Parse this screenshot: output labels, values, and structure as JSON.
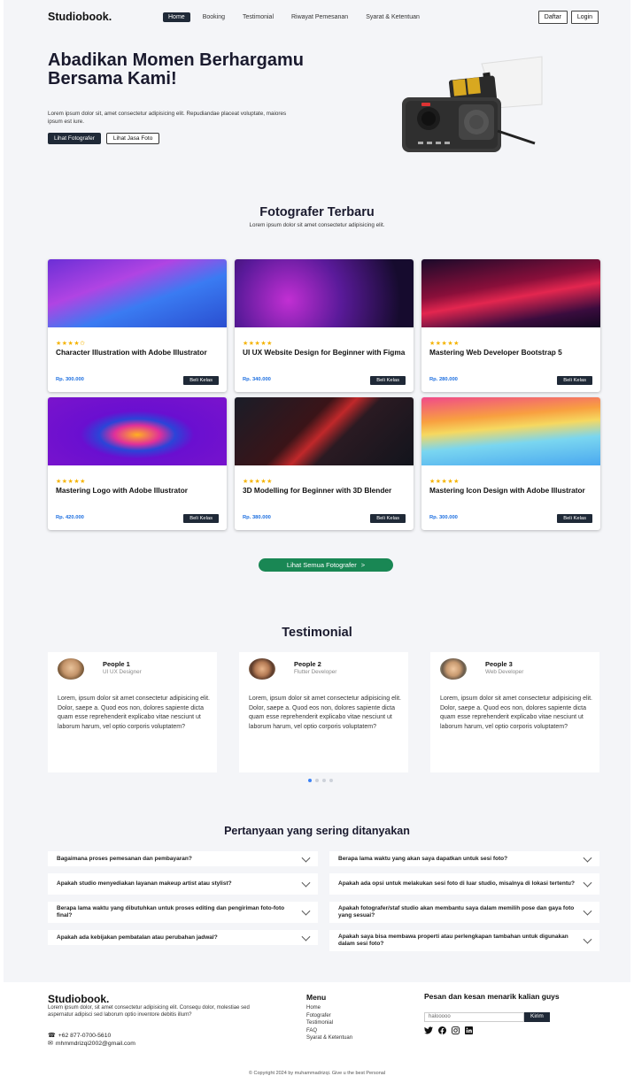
{
  "nav": {
    "brand": "Studiobook.",
    "items": [
      "Home",
      "Booking",
      "Testimonial",
      "Riwayat Pemesanan",
      "Syarat & Ketentuan"
    ],
    "active_index": 0,
    "register": "Daftar",
    "login": "Login"
  },
  "hero": {
    "title": "Abadikan Momen Berhargamu Bersama Kami!",
    "description": "Lorem ipsum dolor sit, amet consectetur adipisicing elit. Repudiandae placeat voluptate, maiores ipsum est iure.",
    "btn_primary": "Lihat Fotografer",
    "btn_secondary": "Lihat Jasa Foto"
  },
  "photographers": {
    "title": "Fotografer Terbaru",
    "subtitle": "Lorem ipsum dolor sit amet consectetur adipisicing elit.",
    "cards": [
      {
        "title": "Character Illustration with Adobe Illustrator",
        "price": "Rp. 300.000",
        "button": "Beli Kelas",
        "rating": 4.5,
        "stars": "★★★★✩"
      },
      {
        "title": "UI UX Website Design for Beginner with Figma",
        "price": "Rp. 340.000",
        "button": "Beli Kelas",
        "rating": 5,
        "stars": "★★★★★"
      },
      {
        "title": "Mastering Web Developer Bootstrap 5",
        "price": "Rp. 280.000",
        "button": "Beli Kelas",
        "rating": 5,
        "stars": "★★★★★"
      },
      {
        "title": "Mastering Logo with Adobe Illustrator",
        "price": "Rp. 420.000",
        "button": "Beli Kelas",
        "rating": 5,
        "stars": "★★★★★"
      },
      {
        "title": "3D Modelling for Beginner with 3D Blender",
        "price": "Rp. 380.000",
        "button": "Beli Kelas",
        "rating": 5,
        "stars": "★★★★★"
      },
      {
        "title": "Mastering Icon Design with Adobe Illustrator",
        "price": "Rp. 300.000",
        "button": "Beli Kelas",
        "rating": 5,
        "stars": "★★★★★"
      }
    ],
    "see_all": "Lihat Semua Fotografer",
    "see_all_arrow": ">"
  },
  "testimonial": {
    "title": "Testimonial",
    "items": [
      {
        "name": "People 1",
        "role": "UI UX Designer",
        "text": "Lorem, ipsum dolor sit amet consectetur adipisicing elit. Dolor, saepe a. Quod eos non, dolores sapiente dicta quam esse reprehenderit explicabo vitae nesciunt ut laborum harum, vel optio corporis voluptatem?"
      },
      {
        "name": "People 2",
        "role": "Flutter Developer",
        "text": "Lorem, ipsum dolor sit amet consectetur adipisicing elit. Dolor, saepe a. Quod eos non, dolores sapiente dicta quam esse reprehenderit explicabo vitae nesciunt ut laborum harum, vel optio corporis voluptatem?"
      },
      {
        "name": "People 3",
        "role": "Web Developer",
        "text": "Lorem, ipsum dolor sit amet consectetur adipisicing elit. Dolor, saepe a. Quod eos non, dolores sapiente dicta quam esse reprehenderit explicabo vitae nesciunt ut laborum harum, vel optio corporis voluptatem?"
      }
    ],
    "active_dot": 0
  },
  "faq": {
    "title": "Pertanyaan yang sering ditanyakan",
    "left": [
      "Bagaimana proses pemesanan dan pembayaran?",
      "Apakah studio menyediakan layanan makeup artist atau stylist?",
      "Berapa lama waktu yang dibutuhkan untuk proses editing dan pengiriman foto-foto final?",
      "Apakah ada kebijakan pembatalan atau perubahan jadwal?"
    ],
    "right": [
      "Berapa lama waktu yang akan saya dapatkan untuk sesi foto?",
      "Apakah ada opsi untuk melakukan sesi foto di luar studio, misalnya di lokasi tertentu?",
      "Apakah fotografer/staf studio akan membantu saya dalam memilih pose dan gaya foto yang sesuai?",
      "Apakah saya bisa membawa properti atau perlengkapan tambahan untuk digunakan dalam sesi foto?"
    ]
  },
  "footer": {
    "brand": "Studiobook.",
    "description": "Lorem ipsum dolor, sit amet consectetur adipisicing elit. Consequ dolor, molestiae sed aspernatur adipisci sed laborum optio inventore debitis illum?",
    "phone": "+62 877-0700-5610",
    "email": "mhmmdrizqi2002@gmail.com",
    "menu_title": "Menu",
    "menu": [
      "Home",
      "Fotografer",
      "Testimonial",
      "FAQ",
      "Syarat & Ketentuan"
    ],
    "feedback_title": "Pesan dan kesan menarik kalian guys",
    "input_placeholder": "halooooo",
    "send": "Kirim",
    "social": [
      "twitter-icon",
      "facebook-icon",
      "instagram-icon",
      "linkedin-icon"
    ],
    "copyright": "© Copyright 2024 by muhammadrizqi. Give u the best Personal"
  }
}
